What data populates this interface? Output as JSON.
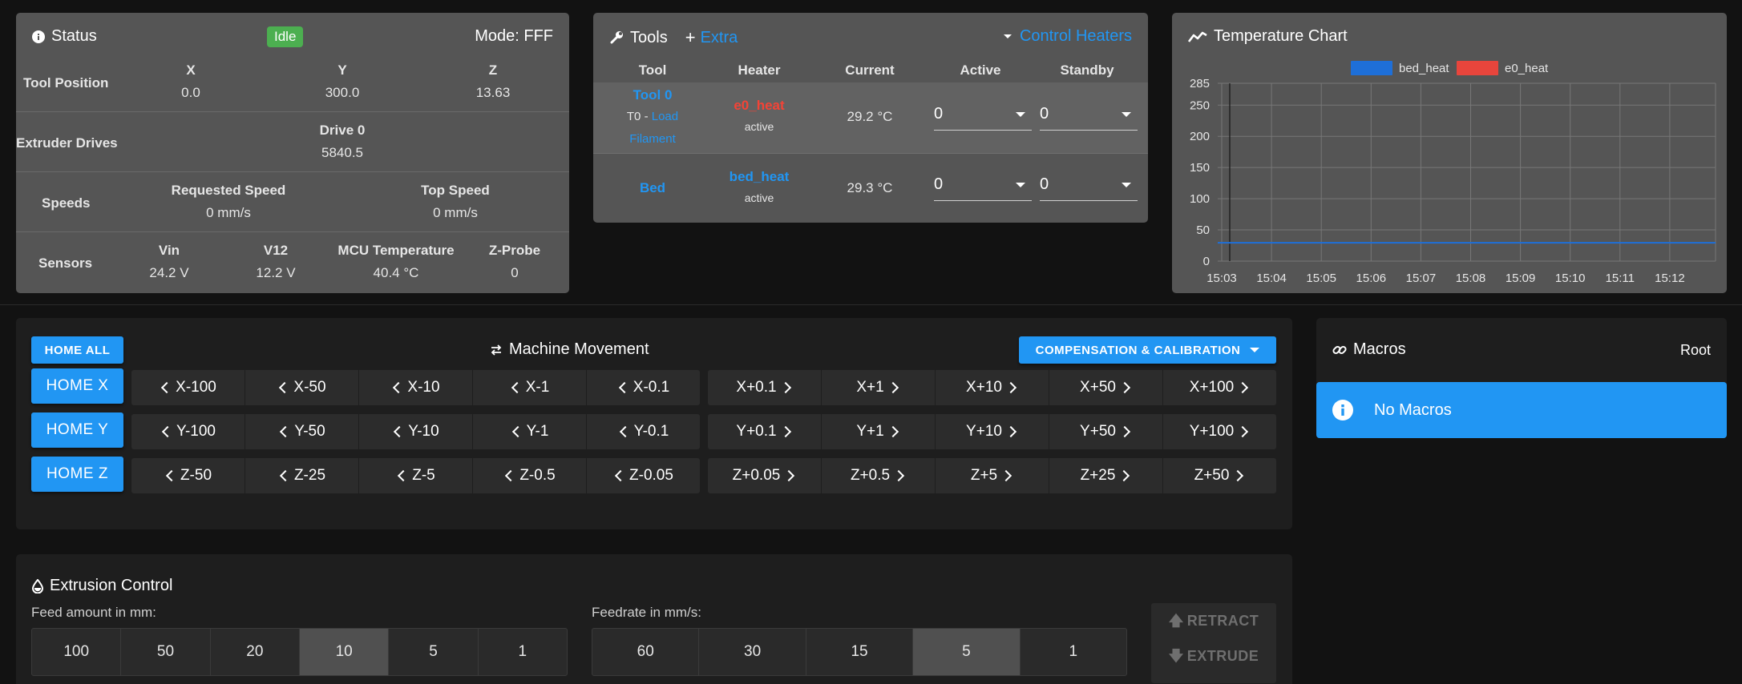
{
  "status": {
    "title": "Status",
    "badge": "Idle",
    "mode": "Mode: FFF",
    "tool_position": {
      "label": "Tool Position",
      "axes": [
        {
          "name": "X",
          "value": "0.0"
        },
        {
          "name": "Y",
          "value": "300.0"
        },
        {
          "name": "Z",
          "value": "13.63"
        }
      ]
    },
    "extruder": {
      "label": "Extruder Drives",
      "drive_name": "Drive 0",
      "drive_value": "5840.5"
    },
    "speeds": {
      "label": "Speeds",
      "requested_label": "Requested Speed",
      "requested_value": "0 mm/s",
      "top_label": "Top Speed",
      "top_value": "0 mm/s"
    },
    "sensors": {
      "label": "Sensors",
      "items": [
        {
          "name": "Vin",
          "value": "24.2 V"
        },
        {
          "name": "V12",
          "value": "12.2 V"
        },
        {
          "name": "MCU Temperature",
          "value": "40.4 °C"
        },
        {
          "name": "Z-Probe",
          "value": "0"
        }
      ]
    }
  },
  "tools": {
    "title": "Tools",
    "extra": "Extra",
    "control_heaters": "Control Heaters",
    "headers": [
      "Tool",
      "Heater",
      "Current",
      "Active",
      "Standby"
    ],
    "rows": [
      {
        "tool": "Tool 0",
        "tool_sub_prefix": "T0 - ",
        "tool_sub_link1": "Load",
        "tool_sub_link2": "Filament",
        "heater": "e0_heat",
        "heater_state": "active",
        "current": "29.2 °C",
        "active": "0",
        "standby": "0"
      },
      {
        "tool": "Bed",
        "heater": "bed_heat",
        "heater_state": "active",
        "current": "29.3 °C",
        "active": "0",
        "standby": "0"
      }
    ]
  },
  "temp_chart": {
    "title": "Temperature Chart",
    "colors": {
      "bed_heat": "#1e6fd8",
      "e0_heat": "#e8453c"
    }
  },
  "chart_data": {
    "type": "line",
    "title": "",
    "xlabel": "",
    "ylabel": "",
    "x": [
      "15:03",
      "15:04",
      "15:05",
      "15:06",
      "15:07",
      "15:08",
      "15:09",
      "15:10",
      "15:11",
      "15:12"
    ],
    "y_ticks": [
      "285",
      "250",
      "200",
      "150",
      "100",
      "50",
      "0"
    ],
    "ylim": [
      0,
      285
    ],
    "series": [
      {
        "name": "bed_heat",
        "values": [
          29.3,
          29.3,
          29.3,
          29.3,
          29.3,
          29.3,
          29.3,
          29.3,
          29.3,
          29.3
        ]
      },
      {
        "name": "e0_heat",
        "values": []
      }
    ],
    "grid": true,
    "legend": "top-center"
  },
  "movement": {
    "title": "Machine Movement",
    "home_all": "HOME ALL",
    "comp_cal": "COMPENSATION & CALIBRATION",
    "rows": [
      {
        "home": "HOME X",
        "neg": [
          "X-100",
          "X-50",
          "X-10",
          "X-1",
          "X-0.1"
        ],
        "pos": [
          "X+0.1",
          "X+1",
          "X+10",
          "X+50",
          "X+100"
        ]
      },
      {
        "home": "HOME Y",
        "neg": [
          "Y-100",
          "Y-50",
          "Y-10",
          "Y-1",
          "Y-0.1"
        ],
        "pos": [
          "Y+0.1",
          "Y+1",
          "Y+10",
          "Y+50",
          "Y+100"
        ]
      },
      {
        "home": "HOME Z",
        "neg": [
          "Z-50",
          "Z-25",
          "Z-5",
          "Z-0.5",
          "Z-0.05"
        ],
        "pos": [
          "Z+0.05",
          "Z+0.5",
          "Z+5",
          "Z+25",
          "Z+50"
        ]
      }
    ]
  },
  "macros": {
    "title": "Macros",
    "root": "Root",
    "empty": "No Macros"
  },
  "extrusion": {
    "title": "Extrusion Control",
    "feed_label": "Feed amount in mm:",
    "feed_options": [
      "100",
      "50",
      "20",
      "10",
      "5",
      "1"
    ],
    "feed_selected": "10",
    "rate_label": "Feedrate in mm/s:",
    "rate_options": [
      "60",
      "30",
      "15",
      "5",
      "1"
    ],
    "rate_selected": "5",
    "retract": "RETRACT",
    "extrude": "EXTRUDE"
  }
}
